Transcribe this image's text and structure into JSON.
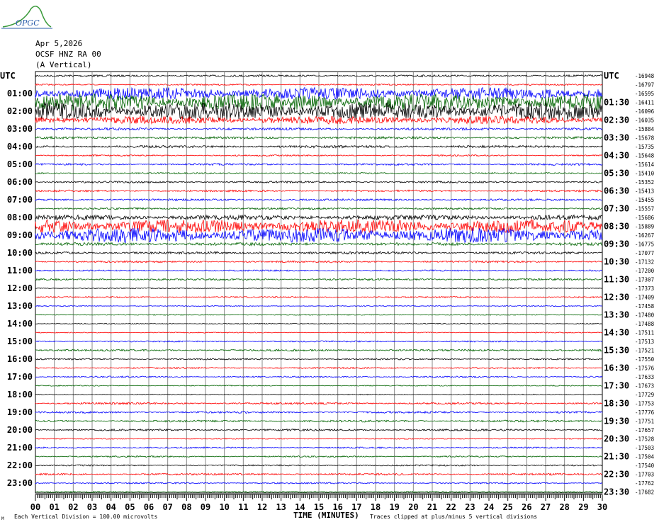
{
  "header": {
    "logo_text": "OPGC",
    "date": "Apr 5,2026",
    "station": "OCSF HNZ RA 00",
    "component": "(A Vertical)"
  },
  "footer": {
    "division": "Each Vertical Division =  100.00 microvolts",
    "xlabel": "TIME (MINUTES)",
    "clip_note": "Traces clipped at plus/minus 5 vertical divisions",
    "corner_mark": "M"
  },
  "chart_data": {
    "type": "line",
    "title": "OCSF HNZ RA 00 (A Vertical) Apr 5,2026",
    "xlabel": "TIME (MINUTES)",
    "xlim": [
      0,
      30
    ],
    "x_ticks": [
      "00",
      "01",
      "02",
      "03",
      "04",
      "05",
      "06",
      "07",
      "08",
      "09",
      "10",
      "11",
      "12",
      "13",
      "14",
      "15",
      "16",
      "17",
      "18",
      "19",
      "20",
      "21",
      "22",
      "23",
      "24",
      "25",
      "26",
      "27",
      "28",
      "29",
      "30"
    ],
    "left_labels": [
      "UTC",
      "01:00",
      "02:00",
      "03:00",
      "04:00",
      "05:00",
      "06:00",
      "07:00",
      "08:00",
      "09:00",
      "10:00",
      "11:00",
      "12:00",
      "13:00",
      "14:00",
      "15:00",
      "16:00",
      "17:00",
      "18:00",
      "19:00",
      "20:00",
      "21:00",
      "22:00",
      "23:00"
    ],
    "right_labels": [
      "UTC",
      "01:30",
      "02:30",
      "03:30",
      "04:30",
      "05:30",
      "06:30",
      "07:30",
      "08:30",
      "09:30",
      "10:30",
      "11:30",
      "12:30",
      "13:30",
      "14:30",
      "15:30",
      "16:30",
      "17:30",
      "18:30",
      "19:30",
      "20:30",
      "21:30",
      "22:30",
      "23:30"
    ],
    "trace_offsets": [
      "-16948",
      "-16797",
      "-16595",
      "-16411",
      "-16096",
      "-16035",
      "-15884",
      "-15678",
      "-15735",
      "-15648",
      "-15614",
      "-15410",
      "-15352",
      "-15413",
      "-15455",
      "-15557",
      "-15686",
      "-15889",
      "-16267",
      "-16775",
      "-17077",
      "-17132",
      "-17200",
      "-17307",
      "-17373",
      "-17409",
      "-17458",
      "-17480",
      "-17488",
      "-17511",
      "-17513",
      "-17521",
      "-17550",
      "-17576",
      "-17633",
      "-17673",
      "-17729",
      "-17753",
      "-17776",
      "-17751",
      "-17657",
      "-17528",
      "-17503",
      "-17504",
      "-17540",
      "-17703",
      "-17762",
      "-17682"
    ],
    "trace_colors": [
      "#000000",
      "#ff0000",
      "#0000ff",
      "#006400"
    ],
    "trace_amplitude_divisions": [
      0.4,
      0.3,
      2.5,
      3.5,
      3.5,
      1.6,
      0.5,
      0.5,
      0.5,
      0.3,
      0.4,
      0.3,
      0.4,
      0.4,
      0.4,
      0.4,
      1.0,
      2.8,
      3.0,
      0.6,
      0.5,
      0.4,
      0.3,
      0.4,
      0.2,
      0.3,
      0.2,
      0.2,
      0.2,
      0.2,
      0.3,
      0.4,
      0.3,
      0.3,
      0.3,
      0.2,
      0.2,
      0.4,
      0.4,
      0.4,
      0.4,
      0.2,
      0.3,
      0.3,
      0.3,
      0.4,
      0.3,
      0.3
    ],
    "y_unit": "100.00 microvolts per division"
  }
}
